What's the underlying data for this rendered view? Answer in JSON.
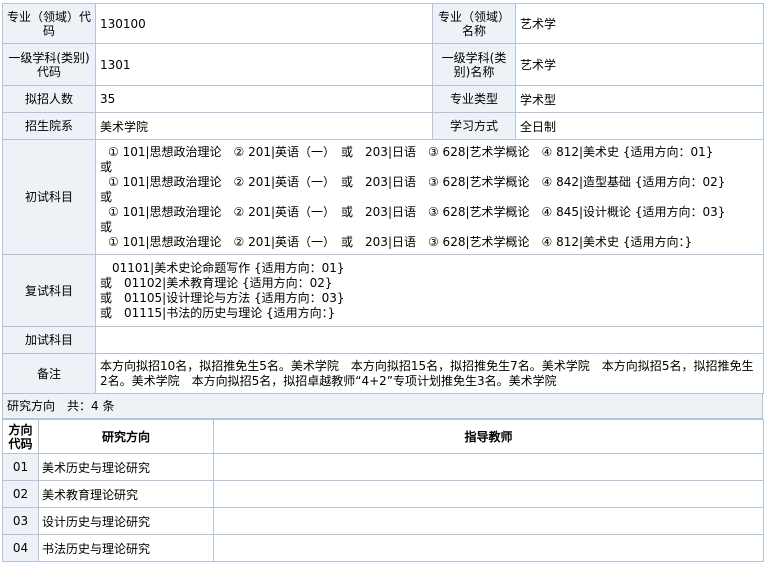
{
  "info": {
    "major_code_label": "专业（领域）代码",
    "major_code": "130100",
    "major_name_label": "专业（领域）名称",
    "major_name": "艺术学",
    "discipline_code_label": "一级学科(类别)代码",
    "discipline_code": "1301",
    "discipline_name_label": "一级学科(类别)名称",
    "discipline_name": "艺术学",
    "enrollment_label": "拟招人数",
    "enrollment": "35",
    "type_label": "专业类型",
    "type": "学术型",
    "college_label": "招生院系",
    "college": "美术学院",
    "mode_label": "学习方式",
    "mode": "全日制"
  },
  "initial_exam": {
    "label": "初试科目",
    "or_word": "或",
    "lines": [
      "① 101|思想政治理论　② 201|英语（一）　或　203|日语　③ 628|艺术学概论　④ 812|美术史 {适用方向：01}",
      "① 101|思想政治理论　② 201|英语（一）　或　203|日语　③ 628|艺术学概论　④ 842|造型基础 {适用方向：02}",
      "① 101|思想政治理论　② 201|英语（一）　或　203|日语　③ 628|艺术学概论　④ 845|设计概论 {适用方向：03}",
      "① 101|思想政治理论　② 201|英语（一）　或　203|日语　③ 628|艺术学概论　④ 812|美术史 {适用方向：}"
    ]
  },
  "retest": {
    "label": "复试科目",
    "lines": [
      "　01101|美术史论命题写作 {适用方向：01}",
      "或　01102|美术教育理论 {适用方向：02}",
      "或　01105|设计理论与方法 {适用方向：03}",
      "或　01115|书法的历史与理论 {适用方向：}"
    ]
  },
  "extra": {
    "label": "加试科目",
    "value": ""
  },
  "remarks": {
    "label": "备注",
    "text": "本方向拟招10名，拟招推免生5名。美术学院　本方向拟招15名，拟招推免生7名。美术学院　本方向拟招5名，拟招推免生2名。美术学院　本方向拟招5名，拟招卓越教师“4+2”专项计划推免生3名。美术学院"
  },
  "research": {
    "title": "研究方向　共：4 条",
    "headers": {
      "code": "方向代码",
      "direction": "研究方向",
      "advisor": "指导教师"
    },
    "rows": [
      {
        "code": "01",
        "name": "美术历史与理论研究",
        "advisor": ""
      },
      {
        "code": "02",
        "name": "美术教育理论研究",
        "advisor": ""
      },
      {
        "code": "03",
        "name": "设计历史与理论研究",
        "advisor": ""
      },
      {
        "code": "04",
        "name": "书法历史与理论研究",
        "advisor": ""
      }
    ]
  }
}
